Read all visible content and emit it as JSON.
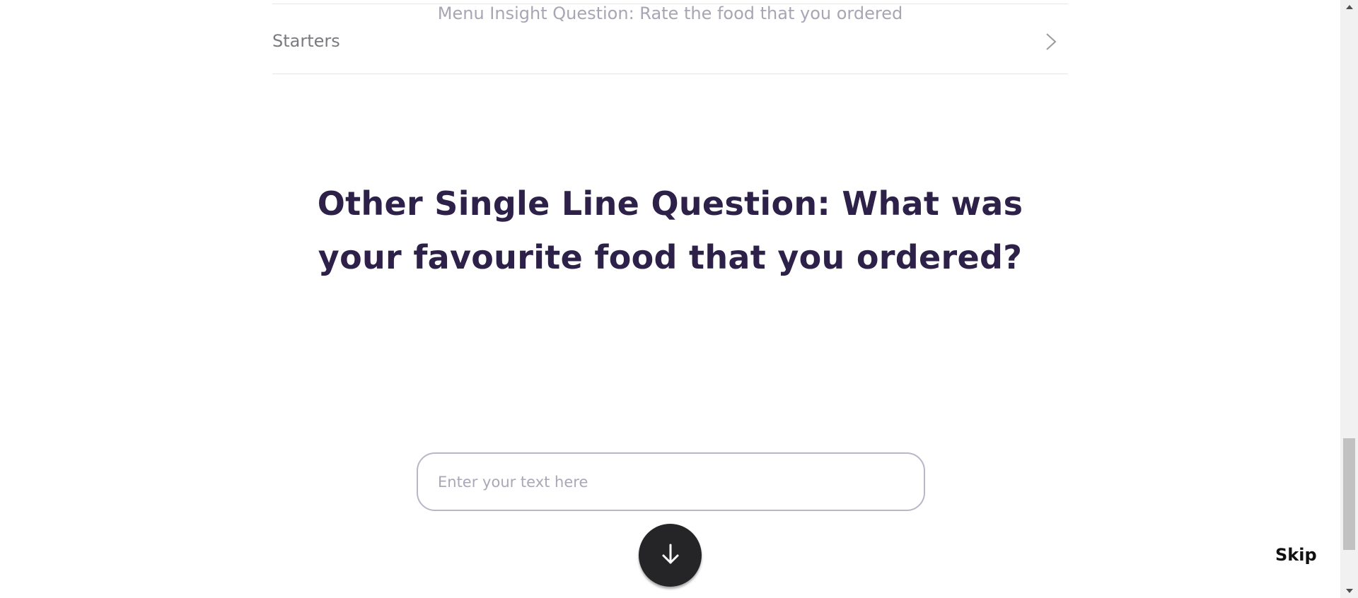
{
  "menu_insight": {
    "question": "Menu Insight Question: Rate the food that you ordered",
    "categories": [
      {
        "label": "Starters"
      }
    ]
  },
  "current_question": {
    "title": "Other Single Line Question: What was your favourite food that you ordered?",
    "input_value": "",
    "input_placeholder": "Enter your text here"
  },
  "controls": {
    "next_icon": "arrow-down-icon",
    "skip_label": "Skip"
  },
  "colors": {
    "question_text": "#2d2149",
    "faded_text": "#a8a5b4",
    "button_bg": "#252528",
    "input_border": "#b9b6c6"
  },
  "icons": {
    "category_chevron": "chevron-right-icon",
    "scroll_up": "triangle-up-icon",
    "scroll_down": "triangle-down-icon"
  }
}
